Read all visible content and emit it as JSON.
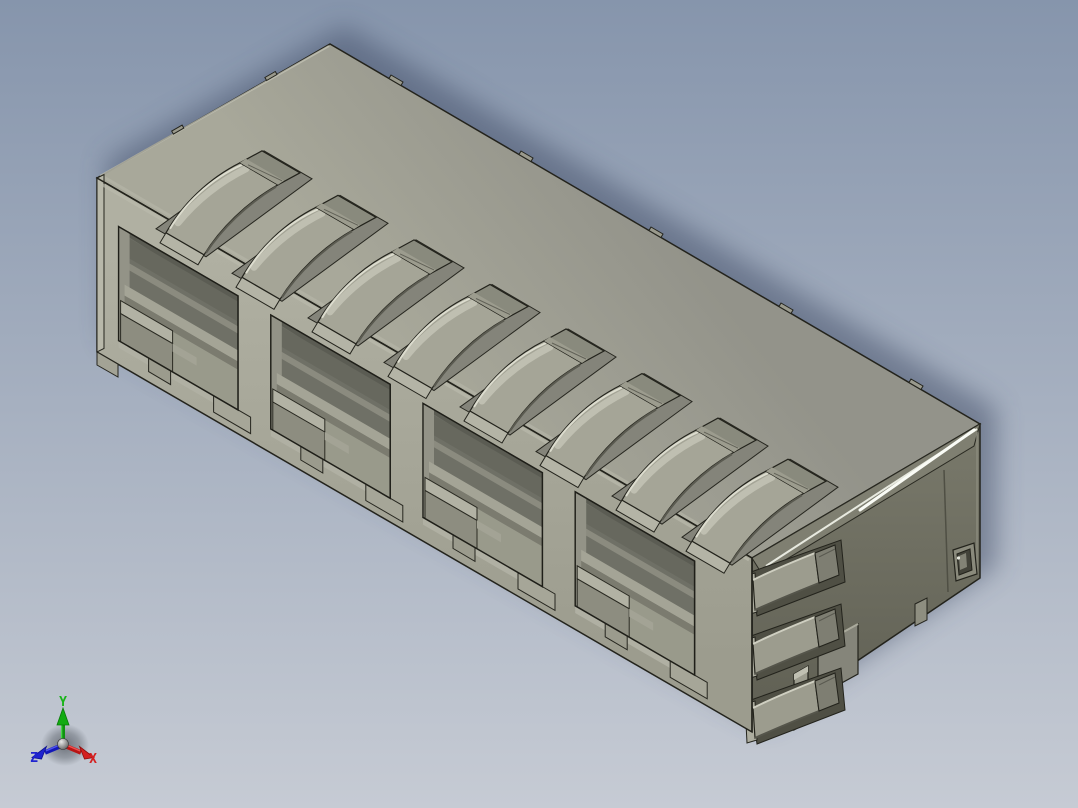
{
  "viewport": {
    "description": "Isometric CAD shaded view of a 4-port shielded modular jack (RJ45) EMI shield housing",
    "background_top": "#8695ac",
    "background_bottom": "#c6cbd4"
  },
  "model": {
    "name": "4-port shielded RJ45 jack housing",
    "port_count": 4,
    "top_emi_finger_count": 8,
    "side_emi_finger_count": 3,
    "colors": {
      "outline": "#23231c",
      "top-face": "#9d9d90",
      "front-face": "#a9a99b",
      "end-face": "#6c6c5f",
      "chamfer": "#7f7f71",
      "interior": "#6f7066",
      "finger": "#a5a597",
      "finger-pad": "#898a7d",
      "block-top": "#b2b2a4",
      "edge-highlight": "#f2f4ec",
      "drop-shadow": "#3e4a63"
    }
  },
  "axis_triad": {
    "x": {
      "label": "X",
      "color": "#d42020"
    },
    "y": {
      "label": "Y",
      "color": "#18b418"
    },
    "z": {
      "label": "Z",
      "color": "#2024d0"
    }
  }
}
